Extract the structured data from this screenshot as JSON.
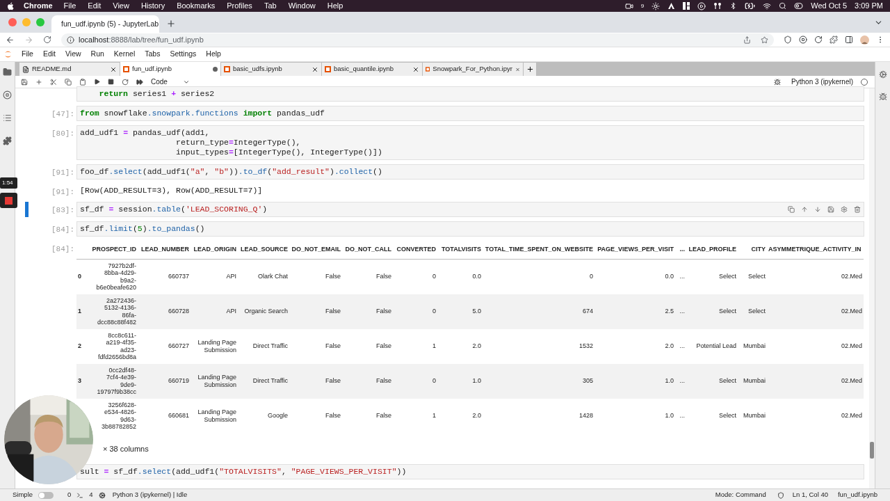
{
  "menu_bar": {
    "app": "Chrome",
    "items": [
      "File",
      "Edit",
      "View",
      "History",
      "Bookmarks",
      "Profiles",
      "Tab",
      "Window",
      "Help"
    ],
    "badge": "9",
    "date": "Wed Oct 5",
    "time": "3:09 PM"
  },
  "browser": {
    "tab_title": "fun_udf.ipynb (5) - JupyterLab",
    "url_host": "localhost",
    "url_path": ":8888/lab/tree/fun_udf.ipynb"
  },
  "jupyter_menu": [
    "File",
    "Edit",
    "View",
    "Run",
    "Kernel",
    "Tabs",
    "Settings",
    "Help"
  ],
  "doc_tabs": [
    {
      "label": "README.md",
      "kind": "markdown",
      "selected": false,
      "dirty": false
    },
    {
      "label": "fun_udf.ipynb",
      "kind": "notebook",
      "selected": true,
      "dirty": true
    },
    {
      "label": "basic_udfs.ipynb",
      "kind": "notebook",
      "selected": false,
      "dirty": false
    },
    {
      "label": "basic_quantile.ipynb",
      "kind": "notebook",
      "selected": false,
      "dirty": false
    },
    {
      "label": "Snowpark_For_Python.ipyr",
      "kind": "notebook",
      "selected": false,
      "dirty": false
    }
  ],
  "toolbar": {
    "cell_type": "Code",
    "kernel": "Python 3 (ipykernel)"
  },
  "recording": {
    "timer": "1:54"
  },
  "cells": [
    {
      "kind": "code",
      "active": false,
      "lines": [
        [
          {
            "kind": "k",
            "text": "    return"
          },
          {
            "kind": "p",
            "text": " series1 "
          },
          {
            "kind": "o",
            "text": "+"
          },
          {
            "kind": "p",
            "text": " series2"
          }
        ]
      ]
    },
    {
      "kind": "code",
      "prompt": "[47]:",
      "active": false,
      "lines": [
        [
          {
            "kind": "k",
            "text": "from"
          },
          {
            "kind": "p",
            "text": " snowflake"
          },
          {
            "kind": "a",
            "text": ".snowpark.functions"
          },
          {
            "kind": "k",
            "text": " import"
          },
          {
            "kind": "p",
            "text": " pandas_udf"
          }
        ]
      ]
    },
    {
      "kind": "code",
      "prompt": "[80]:",
      "active": false,
      "lines": [
        [
          {
            "kind": "p",
            "text": "add_udf1 "
          },
          {
            "kind": "o",
            "text": "="
          },
          {
            "kind": "p",
            "text": " pandas_udf(add1,"
          }
        ],
        [
          {
            "kind": "p",
            "text": "                    return_type"
          },
          {
            "kind": "o",
            "text": "="
          },
          {
            "kind": "p",
            "text": "IntegerType(),"
          }
        ],
        [
          {
            "kind": "p",
            "text": "                    input_types"
          },
          {
            "kind": "o",
            "text": "="
          },
          {
            "kind": "p",
            "text": "[IntegerType(), IntegerType()])"
          }
        ]
      ]
    },
    {
      "kind": "code",
      "prompt": "[91]:",
      "active": false,
      "lines": [
        [
          {
            "kind": "p",
            "text": "foo_df"
          },
          {
            "kind": "a",
            "text": ".select"
          },
          {
            "kind": "p",
            "text": "(add_udf1("
          },
          {
            "kind": "s",
            "text": "\"a\""
          },
          {
            "kind": "p",
            "text": ", "
          },
          {
            "kind": "s",
            "text": "\"b\""
          },
          {
            "kind": "p",
            "text": "))"
          },
          {
            "kind": "a",
            "text": ".to_df"
          },
          {
            "kind": "p",
            "text": "("
          },
          {
            "kind": "s",
            "text": "\"add_result\""
          },
          {
            "kind": "p",
            "text": ")"
          },
          {
            "kind": "a",
            "text": ".collect"
          },
          {
            "kind": "p",
            "text": "()"
          }
        ]
      ]
    },
    {
      "kind": "text_output",
      "prompt": "[91]:",
      "text": "[Row(ADD_RESULT=3), Row(ADD_RESULT=7)]"
    },
    {
      "kind": "code",
      "prompt": "[83]:",
      "active": true,
      "lines": [
        [
          {
            "kind": "p",
            "text": "sf_df "
          },
          {
            "kind": "o",
            "text": "="
          },
          {
            "kind": "p",
            "text": " session"
          },
          {
            "kind": "a",
            "text": ".table"
          },
          {
            "kind": "p",
            "text": "("
          },
          {
            "kind": "s",
            "text": "'LEAD_SCORING_Q'"
          },
          {
            "kind": "p",
            "text": ")"
          }
        ]
      ]
    },
    {
      "kind": "code",
      "prompt": "[84]:",
      "active": false,
      "lines": [
        [
          {
            "kind": "p",
            "text": "sf_df"
          },
          {
            "kind": "a",
            "text": ".limit"
          },
          {
            "kind": "p",
            "text": "("
          },
          {
            "kind": "n",
            "text": "5"
          },
          {
            "kind": "p",
            "text": ")"
          },
          {
            "kind": "a",
            "text": ".to_pandas"
          },
          {
            "kind": "p",
            "text": "()"
          }
        ]
      ]
    },
    {
      "kind": "table_output",
      "prompt": "[84]:",
      "columns": [
        "PROSPECT_ID",
        "LEAD_NUMBER",
        "LEAD_ORIGIN",
        "LEAD_SOURCE",
        "DO_NOT_EMAIL",
        "DO_NOT_CALL",
        "CONVERTED",
        "TOTALVISITS",
        "TOTAL_TIME_SPENT_ON_WEBSITE",
        "PAGE_VIEWS_PER_VISIT",
        "...",
        "LEAD_PROFILE",
        "CITY",
        "ASYMMETRIQUE_ACTIVITY_IN"
      ],
      "rows": [
        {
          "index": "0",
          "cells": [
            "7927b2df-8bba-4d29-b9a2-b6e0beafe620",
            "660737",
            "API",
            "Olark Chat",
            "False",
            "False",
            "0",
            "0.0",
            "0",
            "0.0",
            "...",
            "Select",
            "Select",
            "02.Med"
          ]
        },
        {
          "index": "1",
          "cells": [
            "2a272436-5132-4136-86fa-dcc88c88f482",
            "660728",
            "API",
            "Organic Search",
            "False",
            "False",
            "0",
            "5.0",
            "674",
            "2.5",
            "...",
            "Select",
            "Select",
            "02.Med"
          ]
        },
        {
          "index": "2",
          "cells": [
            "8cc8c611-a219-4f35-ad23-fdfd2656bd8a",
            "660727",
            "Landing Page Submission",
            "Direct Traffic",
            "False",
            "False",
            "1",
            "2.0",
            "1532",
            "2.0",
            "...",
            "Potential Lead",
            "Mumbai",
            "02.Med"
          ]
        },
        {
          "index": "3",
          "cells": [
            "0cc2df48-7cf4-4e39-9de9-19797f9b38cc",
            "660719",
            "Landing Page Submission",
            "Direct Traffic",
            "False",
            "False",
            "0",
            "1.0",
            "305",
            "1.0",
            "...",
            "Select",
            "Mumbai",
            "02.Med"
          ]
        },
        {
          "cells": [
            "3256f628-e534-4826-9d63-3b88782852",
            "660681",
            "Landing Page Submission",
            "Google",
            "False",
            "False",
            "1",
            "2.0",
            "1428",
            "1.0",
            "...",
            "Select",
            "Mumbai",
            "02.Med"
          ]
        }
      ],
      "footer": "× 38 columns"
    },
    {
      "kind": "code",
      "active": false,
      "lines": [
        [
          {
            "kind": "p",
            "text": "sult "
          },
          {
            "kind": "o",
            "text": "="
          },
          {
            "kind": "p",
            "text": " sf_df"
          },
          {
            "kind": "a",
            "text": ".select"
          },
          {
            "kind": "p",
            "text": "(add_udf1("
          },
          {
            "kind": "s",
            "text": "\"TOTALVISITS\""
          },
          {
            "kind": "p",
            "text": ", "
          },
          {
            "kind": "s",
            "text": "\"PAGE_VIEWS_PER_VISIT\""
          },
          {
            "kind": "p",
            "text": "))"
          }
        ]
      ]
    }
  ],
  "status_bar": {
    "mode_label": "Simple",
    "simple_on": false,
    "terminals": "0",
    "kernels": "4",
    "kernel_status": "Python 3 (ipykernel) | Idle",
    "mode": "Mode: Command",
    "cursor": "Ln 1, Col 40",
    "file": "fun_udf.ipynb"
  }
}
